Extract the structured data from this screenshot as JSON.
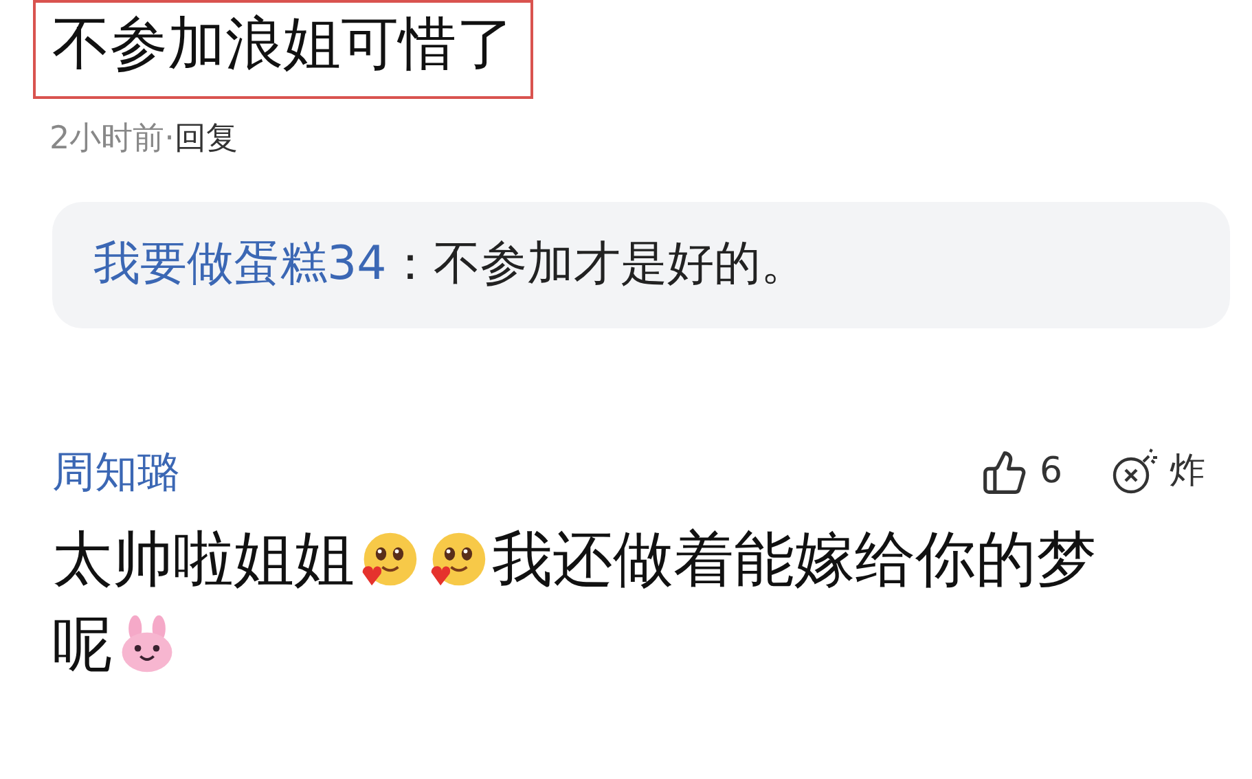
{
  "quoted_comment": {
    "text": "不参加浪姐可惜了",
    "time": "2小时前",
    "separator": "·",
    "reply_action": "回复"
  },
  "reply": {
    "author": "我要做蛋糕34",
    "colon": "：",
    "text": "不参加才是好的。"
  },
  "comment": {
    "author": "周知璐",
    "likes": "6",
    "bomb_label": "炸",
    "body": [
      {
        "kind": "text",
        "text": "太帅啦姐姐"
      },
      {
        "kind": "blush_emoji"
      },
      {
        "kind": "blush_emoji"
      },
      {
        "kind": "text",
        "text": "我还做着能嫁给你的梦呢"
      },
      {
        "kind": "bunny_emoji"
      }
    ]
  }
}
